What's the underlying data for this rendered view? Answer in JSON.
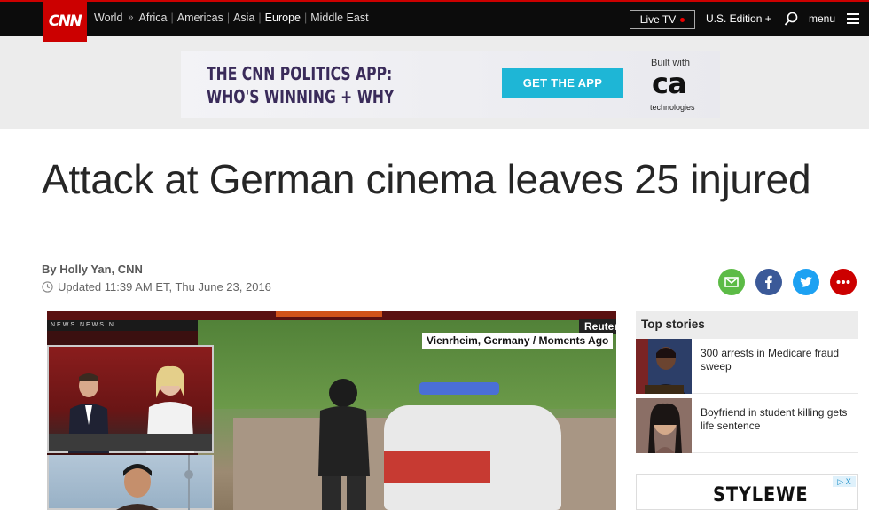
{
  "nav": {
    "logo": "CNN",
    "links": [
      {
        "label": "World"
      },
      {
        "label": "Africa"
      },
      {
        "label": "Americas"
      },
      {
        "label": "Asia"
      },
      {
        "label": "Europe"
      },
      {
        "label": "Middle East"
      }
    ],
    "separator": "»",
    "divider": "|",
    "live_tv": "Live TV",
    "edition": "U.S. Edition +",
    "search_icon": "search-icon",
    "menu": "menu",
    "menu_icon": "hamburger-icon"
  },
  "ad_banner": {
    "headline_line1": "THE CNN POLITICS APP:",
    "headline_line2": "WHO'S WINNING + WHY",
    "cta": "GET THE APP",
    "built_with": "Built with",
    "sponsor_logo": "ca",
    "sponsor_sub": "technologies",
    "colors": {
      "cta": "#1eb6d6",
      "headline": "#3a2b5a"
    }
  },
  "article": {
    "headline": "Attack at German cinema leaves 25 injured",
    "byline": "By Holly Yan, CNN",
    "updated": "Updated 11:39 AM ET, Thu June 23, 2016",
    "share_icons": [
      "email-icon",
      "facebook-icon",
      "twitter-icon",
      "more-icon"
    ],
    "share_colors": {
      "email": "#5cbb46",
      "facebook": "#3b5998",
      "twitter": "#1da1f2",
      "more": "#cc0000"
    }
  },
  "video": {
    "source": "Reuters",
    "caption": "Vienrheim, Germany / Moments Ago",
    "ticker": "NEWS NEWS N"
  },
  "sidebar": {
    "heading": "Top stories",
    "stories": [
      {
        "title": "300 arrests in Medicare fraud sweep"
      },
      {
        "title": "Boyfriend in student killing gets life sentence"
      }
    ],
    "ad_brand": "STYLEWE",
    "ad_choice": "▷ X"
  },
  "colors": {
    "brand_red": "#cc0000",
    "nav_bg": "#0c0c0c"
  }
}
